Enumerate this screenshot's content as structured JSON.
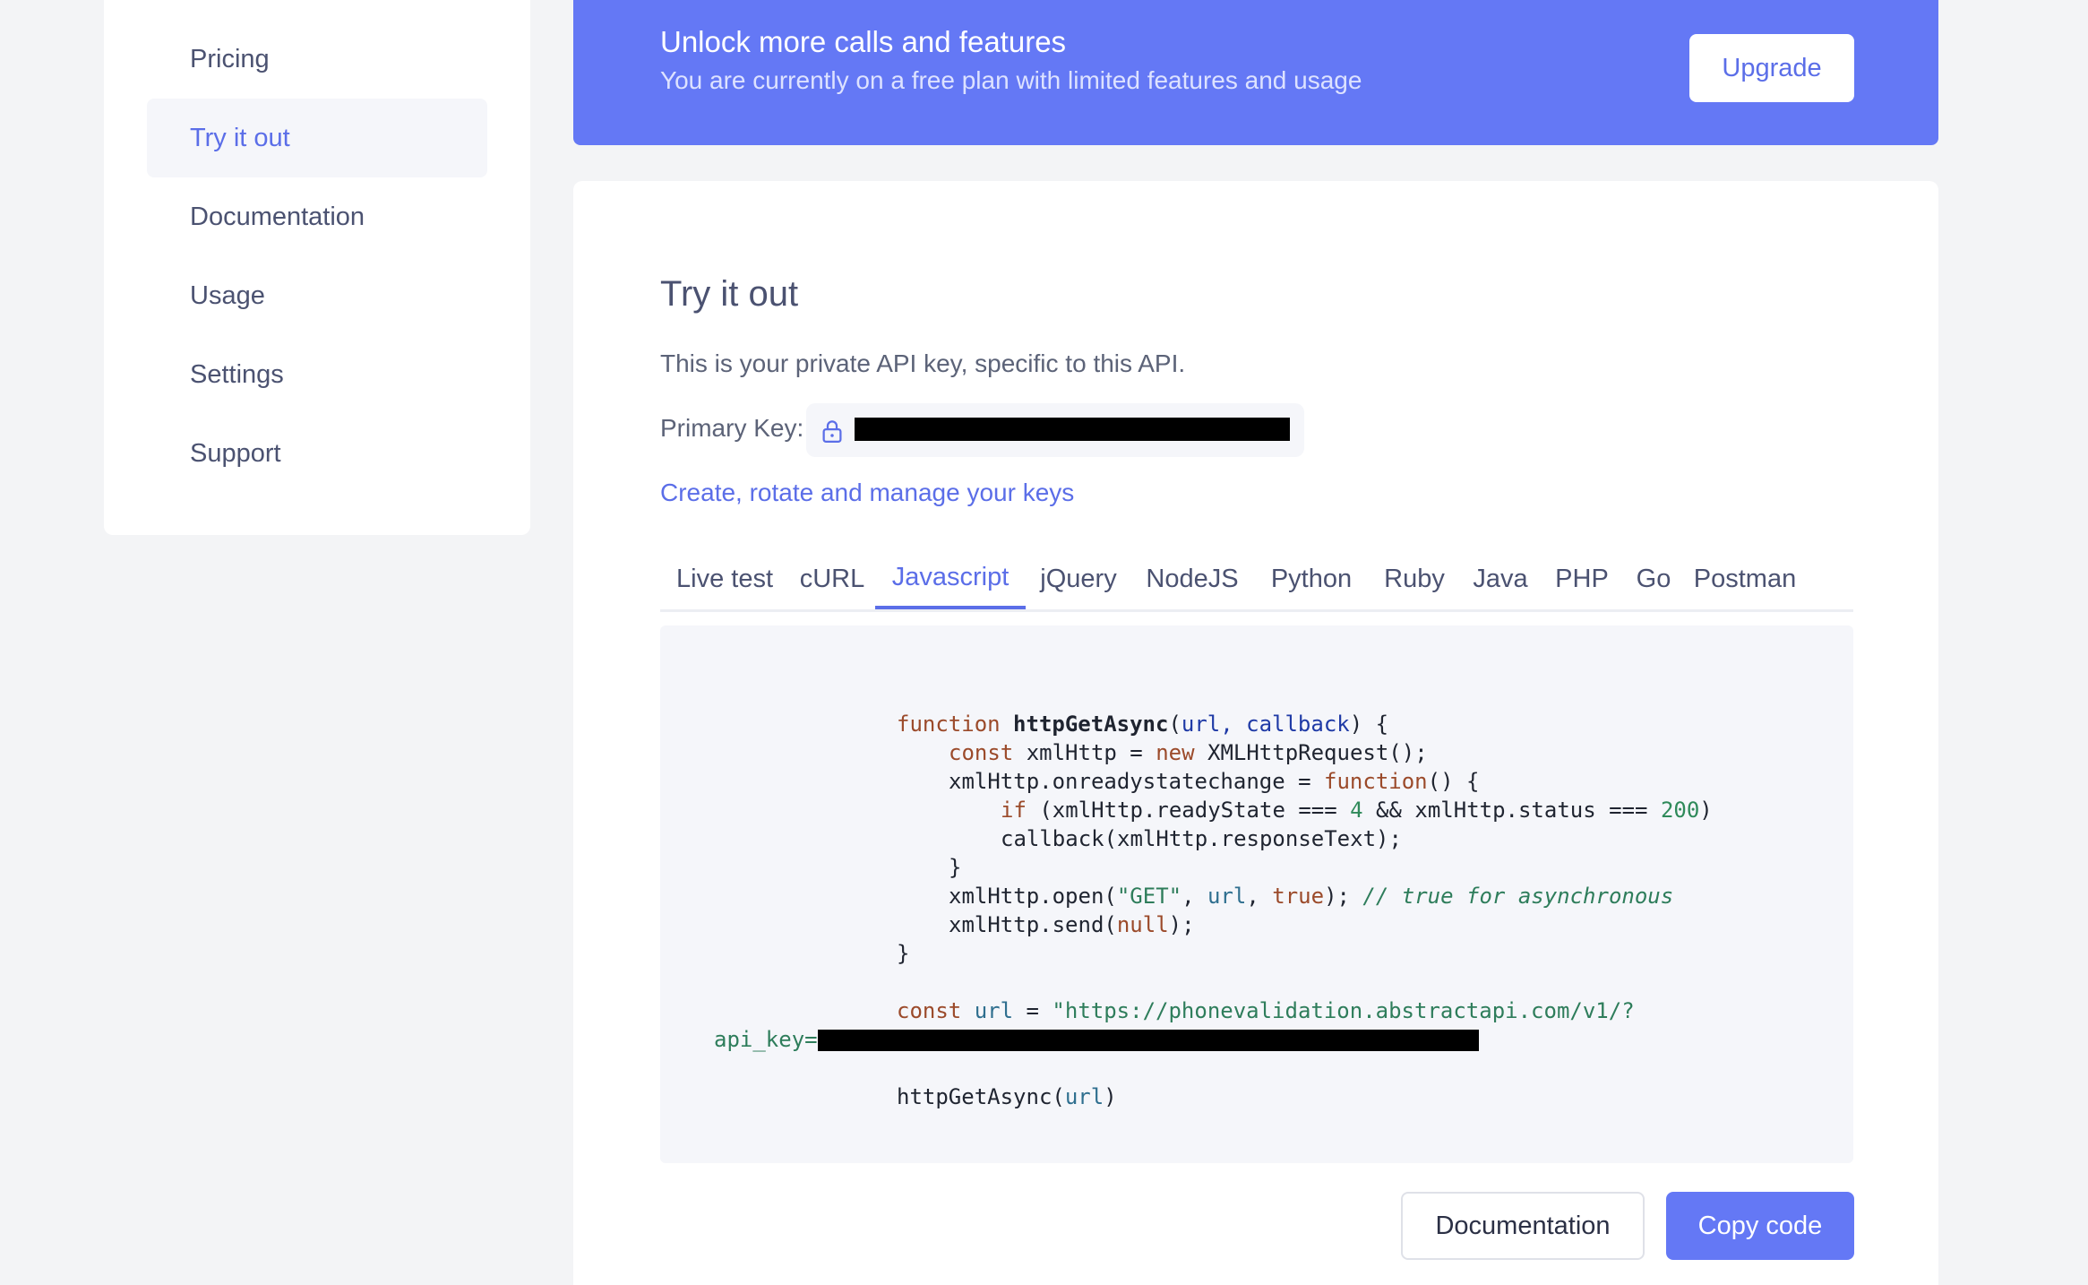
{
  "sidebar": {
    "items": [
      {
        "label": "Pricing",
        "active": false
      },
      {
        "label": "Try it out",
        "active": true
      },
      {
        "label": "Documentation",
        "active": false
      },
      {
        "label": "Usage",
        "active": false
      },
      {
        "label": "Settings",
        "active": false
      },
      {
        "label": "Support",
        "active": false
      }
    ]
  },
  "banner": {
    "title": "Unlock more calls and features",
    "subtitle": "You are currently on a free plan with limited features and usage",
    "upgrade_label": "Upgrade"
  },
  "main": {
    "title": "Try it out",
    "description": "This is your private API key, specific to this API.",
    "key_label": "Primary Key:",
    "manage_link": "Create, rotate and manage your keys",
    "tabs": [
      {
        "label": "Live test",
        "active": false
      },
      {
        "label": "cURL",
        "active": false
      },
      {
        "label": "Javascript",
        "active": true
      },
      {
        "label": "jQuery",
        "active": false
      },
      {
        "label": "NodeJS",
        "active": false
      },
      {
        "label": "Python",
        "active": false
      },
      {
        "label": "Ruby",
        "active": false
      },
      {
        "label": "Java",
        "active": false
      },
      {
        "label": "PHP",
        "active": false
      },
      {
        "label": "Go",
        "active": false
      },
      {
        "label": "Postman",
        "active": false
      }
    ],
    "code": {
      "l1_kw": "function",
      "l1_fn": "httpGetAsync",
      "l1_open": "(",
      "l1_params": "url, callback",
      "l1_close": ") {",
      "l2_kw": "const",
      "l2_mid": " xmlHttp = ",
      "l2_kw2": "new",
      "l2_end": " XMLHttpRequest();",
      "l3_start": "xmlHttp.onreadystatechange = ",
      "l3_kw": "function",
      "l3_end": "() {",
      "l4_kw": "if",
      "l4_a": " (xmlHttp.readyState === ",
      "l4_n1": "4",
      "l4_b": " && xmlHttp.status === ",
      "l4_n2": "200",
      "l4_c": ")",
      "l5": "callback(xmlHttp.responseText);",
      "l6": "}",
      "l7_a": "xmlHttp.open(",
      "l7_str": "\"GET\"",
      "l7_b": ", ",
      "l7_url": "url",
      "l7_c": ", ",
      "l7_kw": "true",
      "l7_d": "); ",
      "l7_cm": "// true for asynchronous",
      "l8_a": "xmlHttp.send(",
      "l8_kw": "null",
      "l8_b": ");",
      "l9": "}",
      "l10_kw": "const",
      "l10_sp": " ",
      "l10_var": "url",
      "l10_eq": " = ",
      "l10_str": "\"https://phonevalidation.abstractapi.com/v1/?",
      "l11_str": "api_key=",
      "l12_a": "httpGetAsync(",
      "l12_var": "url",
      "l12_b": ")"
    },
    "documentation_label": "Documentation",
    "copy_label": "Copy code"
  }
}
